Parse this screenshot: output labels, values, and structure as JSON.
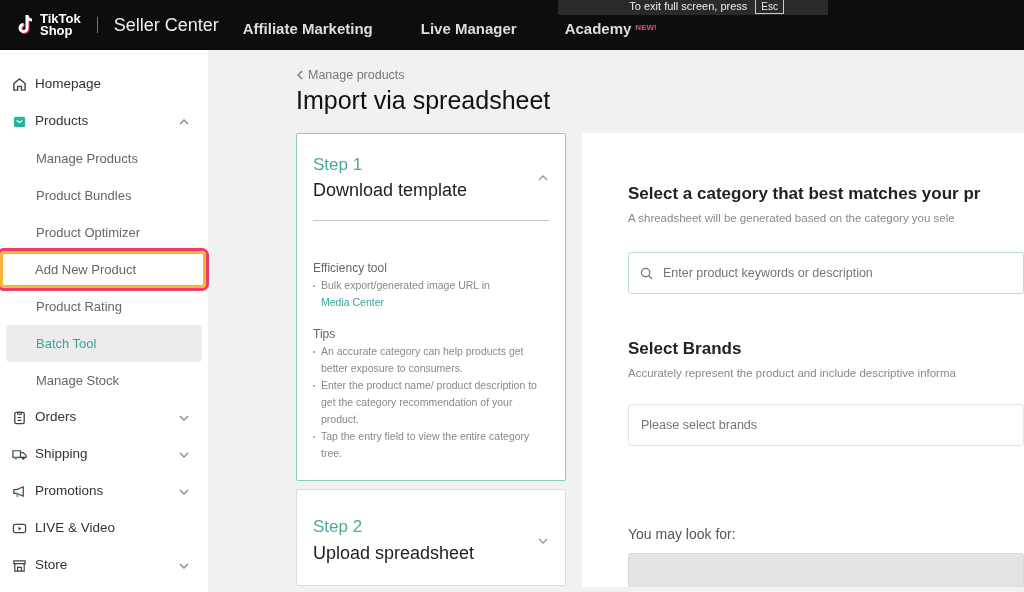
{
  "header": {
    "logo_line1": "TikTok",
    "logo_line2": "Shop",
    "title": "Seller Center",
    "nav": [
      {
        "label": "Affiliate Marketing"
      },
      {
        "label": "Live Manager"
      },
      {
        "label": "Academy",
        "badge": "NEW!"
      }
    ]
  },
  "fullscreen_notice": {
    "text": "To exit full screen, press",
    "key": "Esc"
  },
  "sidebar": {
    "items": [
      {
        "label": "Homepage"
      },
      {
        "label": "Products",
        "expanded": true,
        "children": [
          {
            "label": "Manage Products",
            "selected": false,
            "highlighted": false
          },
          {
            "label": "Product Bundles",
            "selected": false,
            "highlighted": false
          },
          {
            "label": "Product Optimizer",
            "selected": false,
            "highlighted": false
          },
          {
            "label": "Add New Product",
            "selected": false,
            "highlighted": true
          },
          {
            "label": "Product Rating",
            "selected": false,
            "highlighted": false
          },
          {
            "label": "Batch Tool",
            "selected": true,
            "highlighted": false
          },
          {
            "label": "Manage Stock",
            "selected": false,
            "highlighted": false
          }
        ]
      },
      {
        "label": "Orders",
        "expanded": false
      },
      {
        "label": "Shipping",
        "expanded": false
      },
      {
        "label": "Promotions",
        "expanded": false
      },
      {
        "label": "LIVE & Video"
      },
      {
        "label": "Store",
        "expanded": false
      }
    ]
  },
  "breadcrumb": "Manage products",
  "page_title": "Import via spreadsheet",
  "steps": [
    {
      "step": "Step 1",
      "title": "Download template",
      "expanded": true,
      "sections": [
        {
          "heading": "Efficiency tool",
          "bullets": [
            {
              "text": "Bulk export/generated image URL in",
              "link": "Media Center"
            }
          ]
        },
        {
          "heading": "Tips",
          "bullets": [
            {
              "text": "An accurate category can help products get better exposure to consumers."
            },
            {
              "text": "Enter the product name/ product description to get the category recommendation of your product."
            },
            {
              "text": "Tap the entry field to view the entire category tree."
            }
          ]
        }
      ]
    },
    {
      "step": "Step 2",
      "title": "Upload spreadsheet",
      "expanded": false
    }
  ],
  "category": {
    "title": "Select a category that best matches your pr",
    "subtitle": "A shreadsheet will be generated based on the category you sele",
    "search_placeholder": "Enter product keywords or description"
  },
  "brands": {
    "title": "Select Brands",
    "subtitle": "Accurately represent the product and include descriptive informa",
    "placeholder": "Please select brands"
  },
  "suggestions": {
    "label": "You may look for:"
  }
}
